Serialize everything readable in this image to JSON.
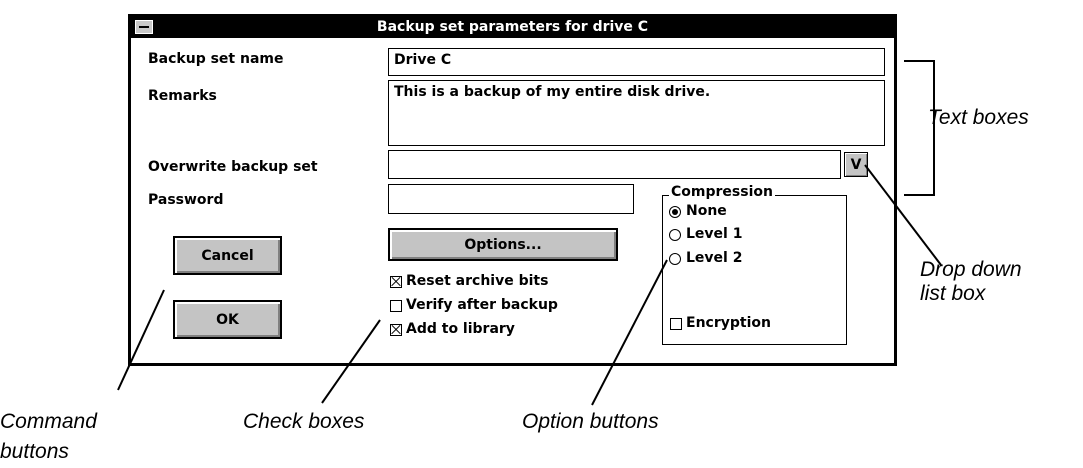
{
  "dialog": {
    "title": "Backup set parameters for drive C",
    "labels": {
      "backup_set_name": "Backup set name",
      "remarks": "Remarks",
      "overwrite_backup_set": "Overwrite backup set",
      "password": "Password"
    },
    "fields": {
      "backup_set_name": "Drive C",
      "remarks": "This is a backup of my entire disk drive.",
      "overwrite_backup_set": "",
      "password": ""
    },
    "dropdown_button": "V",
    "buttons": {
      "cancel": "Cancel",
      "ok": "OK",
      "options": "Options..."
    },
    "checkboxes": [
      {
        "label": "Reset archive bits",
        "checked": true
      },
      {
        "label": "Verify after backup",
        "checked": false
      },
      {
        "label": "Add to library",
        "checked": true
      }
    ],
    "compression": {
      "title": "Compression",
      "options": [
        {
          "label": "None",
          "selected": true
        },
        {
          "label": "Level 1",
          "selected": false
        },
        {
          "label": "Level 2",
          "selected": false
        }
      ],
      "encryption": {
        "label": "Encryption",
        "checked": false
      }
    }
  },
  "callouts": {
    "text_boxes": "Text boxes",
    "drop_down": [
      "Drop down",
      "list box"
    ],
    "command_buttons": [
      "Command",
      "buttons"
    ],
    "check_boxes": "Check boxes",
    "option_buttons": "Option buttons"
  }
}
